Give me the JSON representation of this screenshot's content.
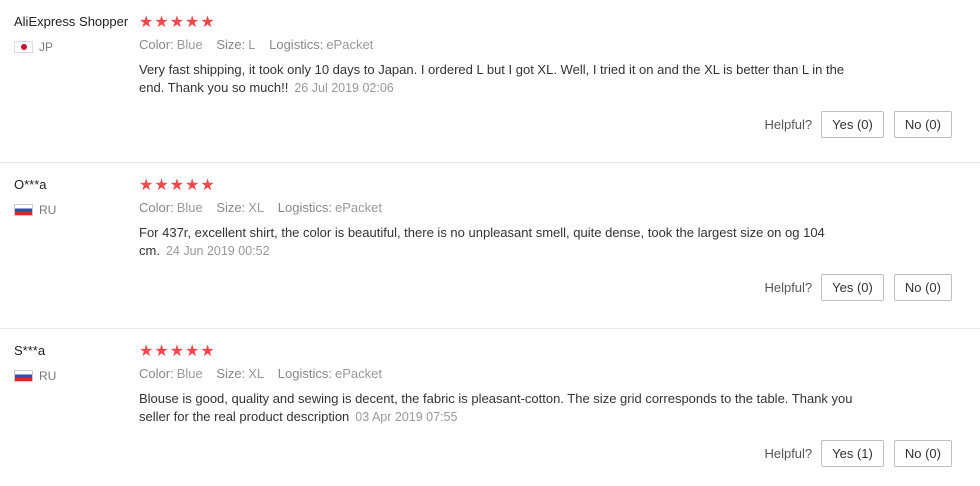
{
  "labels": {
    "color": "Color:",
    "size": "Size:",
    "logistics": "Logistics:",
    "helpful": "Helpful?"
  },
  "rating_color": "#f2474b",
  "reviews": [
    {
      "user": "AliExpress Shopper",
      "country": "JP",
      "flag_icon": "japan-flag-icon",
      "stars": "★★★★★",
      "rating": 5,
      "color": "Blue",
      "size": "L",
      "logistics": "ePacket",
      "text": "Very fast shipping, it took only 10 days to Japan. I ordered L but I got XL. Well, I tried it on and the XL is better than L in the end. Thank you so much!!",
      "date": "26 Jul 2019 02:06",
      "yes": "Yes (0)",
      "no": "No (0)"
    },
    {
      "user": "O***a",
      "country": "RU",
      "flag_icon": "russia-flag-icon",
      "stars": "★★★★★",
      "rating": 5,
      "color": "Blue",
      "size": "XL",
      "logistics": "ePacket",
      "text": "For 437r, excellent shirt, the color is beautiful, there is no unpleasant smell, quite dense, took the largest size on og 104 cm.",
      "date": "24 Jun 2019 00:52",
      "yes": "Yes (0)",
      "no": "No (0)"
    },
    {
      "user": "S***a",
      "country": "RU",
      "flag_icon": "russia-flag-icon",
      "stars": "★★★★★",
      "rating": 5,
      "color": "Blue",
      "size": "XL",
      "logistics": "ePacket",
      "text": "Blouse is good, quality and sewing is decent, the fabric is pleasant-cotton. The size grid corresponds to the table. Thank you seller for the real product description",
      "date": "03 Apr 2019 07:55",
      "yes": "Yes (1)",
      "no": "No (0)"
    }
  ]
}
